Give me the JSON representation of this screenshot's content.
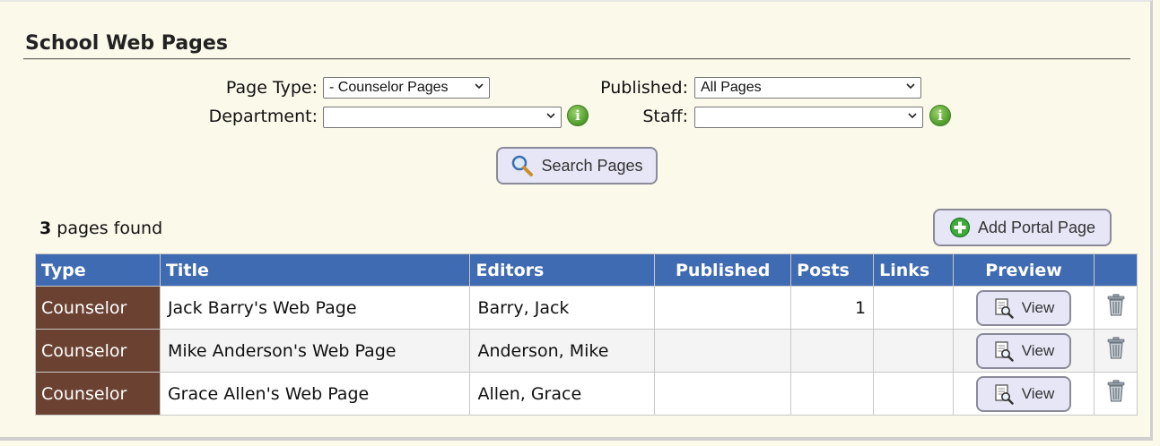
{
  "page": {
    "title": "School Web Pages"
  },
  "filters": {
    "page_type": {
      "label": "Page Type:",
      "value": "- Counselor Pages"
    },
    "published": {
      "label": "Published:",
      "value": "All Pages"
    },
    "department": {
      "label": "Department:",
      "value": ""
    },
    "staff": {
      "label": "Staff:",
      "value": ""
    },
    "info_glyph": "i"
  },
  "search_button": {
    "label": "Search Pages",
    "icon": "magnifier-icon"
  },
  "results": {
    "count": "3",
    "count_suffix": " pages found"
  },
  "add_button": {
    "label": "Add Portal Page",
    "icon": "plus-circle-icon"
  },
  "table": {
    "columns": [
      "Type",
      "Title",
      "Editors",
      "Published",
      "Posts",
      "Links",
      "Preview",
      ""
    ],
    "rows": [
      {
        "type": "Counselor",
        "title": "Jack Barry's Web Page",
        "editors": "Barry, Jack",
        "published": "",
        "posts": "1",
        "links": "",
        "preview": "View"
      },
      {
        "type": "Counselor",
        "title": "Mike Anderson's Web Page",
        "editors": "Anderson, Mike",
        "published": "",
        "posts": "",
        "links": "",
        "preview": "View"
      },
      {
        "type": "Counselor",
        "title": "Grace Allen's Web Page",
        "editors": "Allen, Grace",
        "published": "",
        "posts": "",
        "links": "",
        "preview": "View"
      }
    ]
  },
  "colors": {
    "header_blue": "#3f6bb2",
    "type_brown": "#6b4232",
    "background": "#fbf9ea",
    "button": "#e6e6f6"
  }
}
